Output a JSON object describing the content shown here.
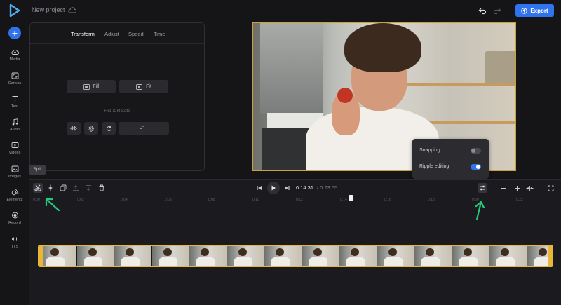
{
  "header": {
    "project_name": "New project",
    "export_label": "Export",
    "brand_color": "#2f73ee"
  },
  "rail": {
    "items": [
      {
        "label": "Media",
        "icon": "cloud-upload-icon"
      },
      {
        "label": "Canvas",
        "icon": "canvas-icon"
      },
      {
        "label": "Text",
        "icon": "text-icon"
      },
      {
        "label": "Audio",
        "icon": "music-note-icon"
      },
      {
        "label": "Videos",
        "icon": "video-icon"
      },
      {
        "label": "Images",
        "icon": "image-icon"
      },
      {
        "label": "Elements",
        "icon": "shapes-icon"
      },
      {
        "label": "Record",
        "icon": "record-icon"
      },
      {
        "label": "TTS",
        "icon": "waveform-icon"
      }
    ]
  },
  "panel": {
    "tabs": [
      "Transform",
      "Adjust",
      "Speed",
      "Time"
    ],
    "active_tab": "Transform",
    "fill_label": "Fill",
    "fit_label": "Fit",
    "flip_rotate_title": "Flip & Rotate",
    "rotation_value": "0°",
    "minus": "−",
    "plus": "+"
  },
  "popup": {
    "snapping_label": "Snapping",
    "snapping_on": false,
    "ripple_label": "Ripple editing",
    "ripple_on": true
  },
  "tooltip": {
    "text": "Split"
  },
  "player": {
    "current_time": "0:14.31",
    "total_time": "/ 0:23.55"
  },
  "ruler": {
    "ticks": [
      "0:00",
      "0:02",
      "0:04",
      "0:06",
      "0:08",
      "0:10",
      "0:12",
      "0:14",
      "0:16",
      "0:18",
      "0:20",
      "0:22"
    ]
  },
  "clip": {
    "thumbnail_count": 14
  }
}
